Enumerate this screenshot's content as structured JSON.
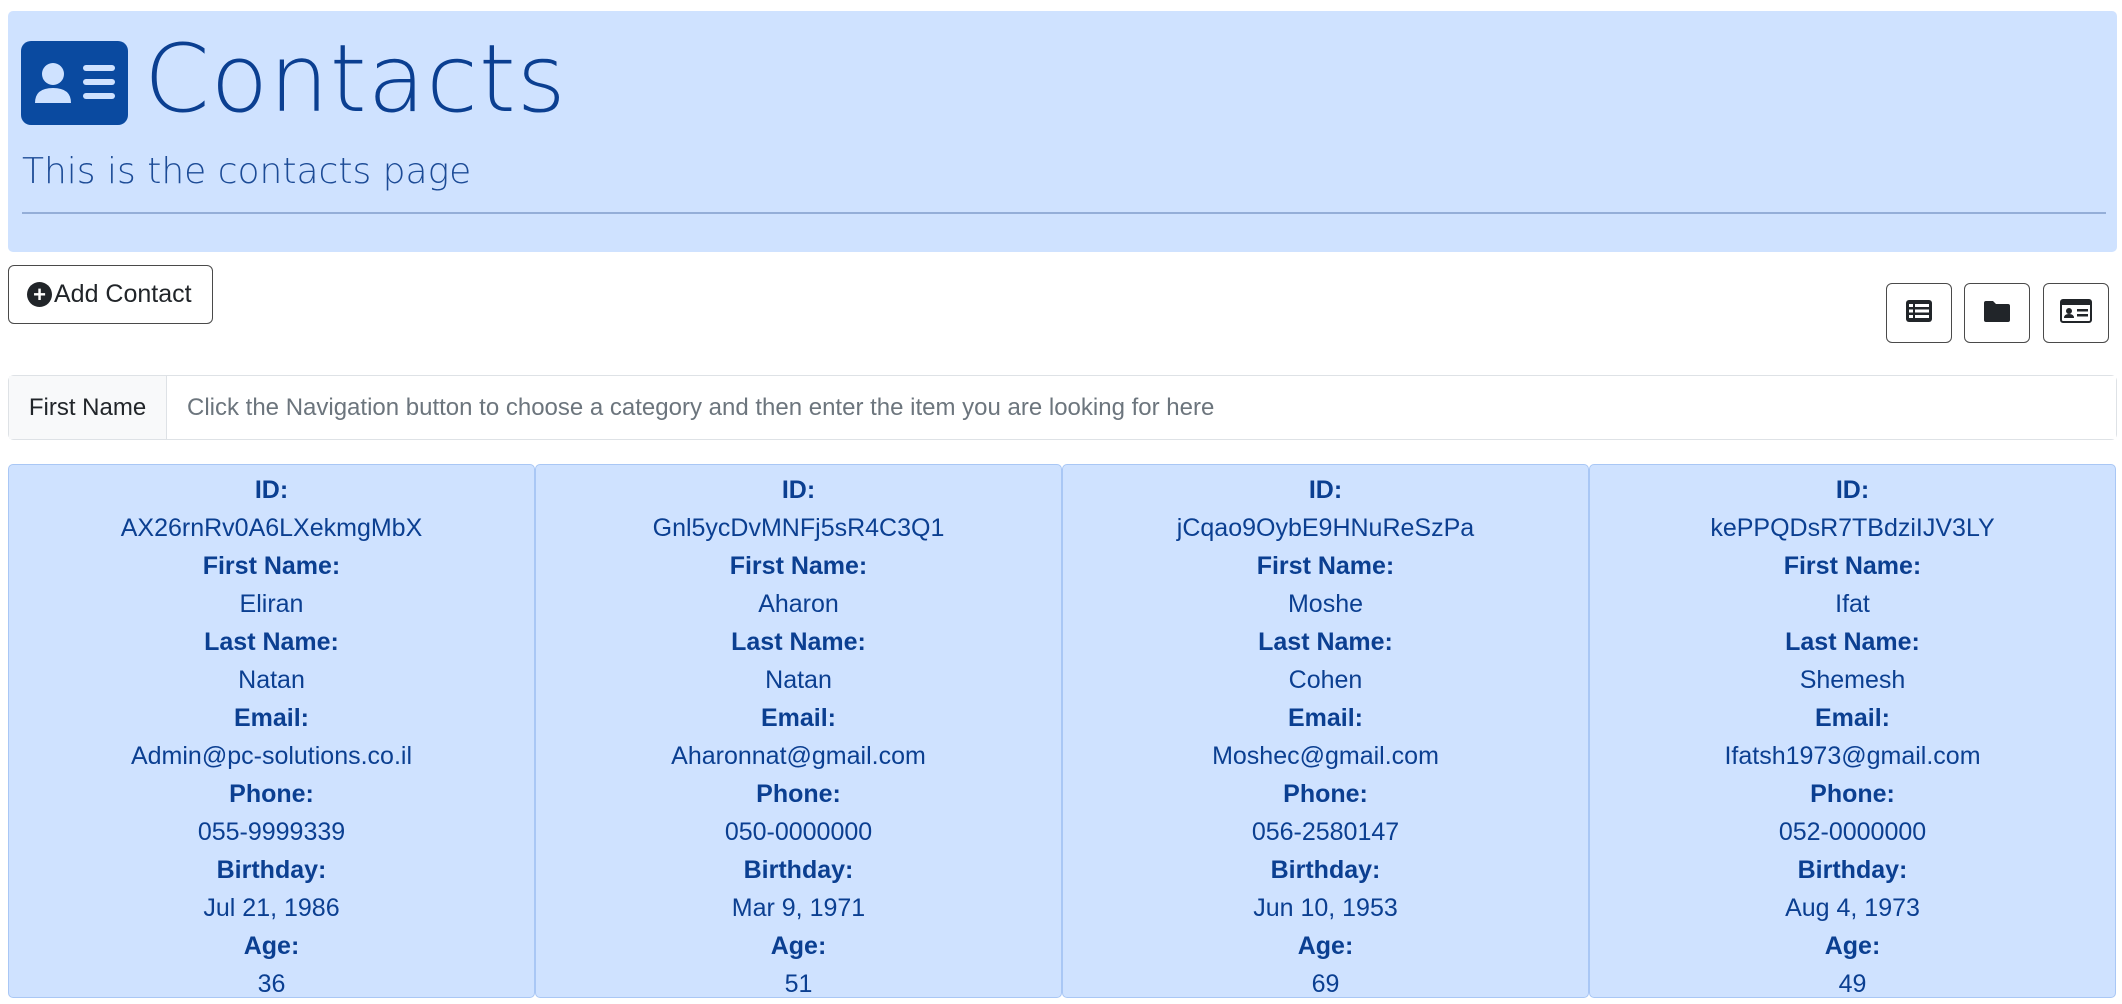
{
  "header": {
    "title": "Contacts",
    "subtitle": "This is the contacts page",
    "logo_icon": "contact-card-icon",
    "background": "#cfe2ff",
    "accent": "#0a4aa0"
  },
  "toolbar": {
    "add_label": "Add Contact",
    "add_icon": "plus-circle-icon",
    "views": [
      {
        "name": "table-view",
        "icon": "table-list-icon"
      },
      {
        "name": "folder-view",
        "icon": "folder-icon"
      },
      {
        "name": "card-view",
        "icon": "id-card-icon"
      }
    ]
  },
  "search": {
    "category": "First Name",
    "placeholder": "Click the Navigation button to choose a category and then enter the item you are looking for here",
    "value": ""
  },
  "field_labels": {
    "id": "ID:",
    "first_name": "First Name:",
    "last_name": "Last Name:",
    "email": "Email:",
    "phone": "Phone:",
    "birthday": "Birthday:",
    "age": "Age:"
  },
  "contacts": [
    {
      "id": "AX26rnRv0A6LXekmgMbX",
      "first_name": "Eliran",
      "last_name": "Natan",
      "email": "Admin@pc-solutions.co.il",
      "phone": "055-9999339",
      "birthday": "Jul 21, 1986",
      "age": "36"
    },
    {
      "id": "Gnl5ycDvMNFj5sR4C3Q1",
      "first_name": "Aharon",
      "last_name": "Natan",
      "email": "Aharonnat@gmail.com",
      "phone": "050-0000000",
      "birthday": "Mar 9, 1971",
      "age": "51"
    },
    {
      "id": "jCqao9OybE9HNuReSzPa",
      "first_name": "Moshe",
      "last_name": "Cohen",
      "email": "Moshec@gmail.com",
      "phone": "056-2580147",
      "birthday": "Jun 10, 1953",
      "age": "69"
    },
    {
      "id": "kePPQDsR7TBdziIJV3LY",
      "first_name": "Ifat",
      "last_name": "Shemesh",
      "email": "Ifatsh1973@gmail.com",
      "phone": "052-0000000",
      "birthday": "Aug 4, 1973",
      "age": "49"
    }
  ]
}
